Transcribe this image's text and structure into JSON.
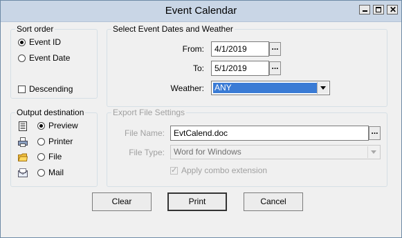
{
  "window": {
    "title": "Event Calendar"
  },
  "sort_order": {
    "label": "Sort order",
    "options": [
      "Event ID",
      "Event Date"
    ],
    "selected": "Event ID",
    "descending_label": "Descending",
    "descending_checked": false
  },
  "dates": {
    "label": "Select Event Dates and Weather",
    "from_label": "From:",
    "from_value": "4/1/2019",
    "to_label": "To:",
    "to_value": "5/1/2019",
    "weather_label": "Weather:",
    "weather_value": "ANY",
    "browse_label": "..."
  },
  "output": {
    "label": "Output destination",
    "options": [
      {
        "label": "Preview",
        "icon": "preview-icon",
        "selected": true
      },
      {
        "label": "Printer",
        "icon": "printer-icon",
        "selected": false
      },
      {
        "label": "File",
        "icon": "folder-icon",
        "selected": false
      },
      {
        "label": "Mail",
        "icon": "mail-icon",
        "selected": false
      }
    ]
  },
  "export": {
    "label": "Export  File Settings",
    "file_name_label": "File Name:",
    "file_name_value": "EvtCalend.doc",
    "file_type_label": "File Type:",
    "file_type_value": "Word for Windows",
    "apply_label": "Apply combo extension",
    "apply_checked": true
  },
  "buttons": {
    "clear": "Clear",
    "print": "Print",
    "cancel": "Cancel"
  },
  "colors": {
    "title_bar": "#c9d6e6",
    "selection": "#3a7bd5",
    "disabled_text": "#a0a0a0"
  }
}
